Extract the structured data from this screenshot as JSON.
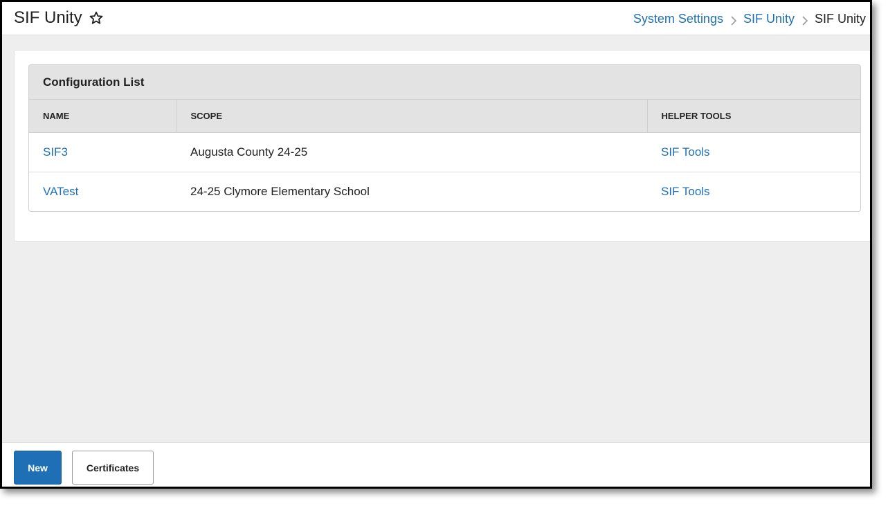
{
  "header": {
    "title": "SIF Unity",
    "breadcrumb": [
      {
        "label": "System Settings"
      },
      {
        "label": "SIF Unity"
      },
      {
        "label": "SIF Unity"
      }
    ]
  },
  "config_list": {
    "title": "Configuration List",
    "columns": [
      "NAME",
      "SCOPE",
      "HELPER TOOLS"
    ],
    "rows": [
      {
        "name": "SIF3",
        "scope": "Augusta County 24-25",
        "tools": "SIF Tools"
      },
      {
        "name": "VATest",
        "scope": "24-25 Clymore Elementary School",
        "tools": "SIF Tools"
      }
    ]
  },
  "footer": {
    "new_label": "New",
    "certificates_label": "Certificates"
  },
  "colors": {
    "link": "#1f6fb6",
    "primary_button": "#1f6fb6",
    "page_background": "#eeeeee",
    "table_header": "#e3e3e3"
  },
  "icons": {
    "favorite": "star-outline-icon",
    "separator": "chevron-right-icon"
  }
}
